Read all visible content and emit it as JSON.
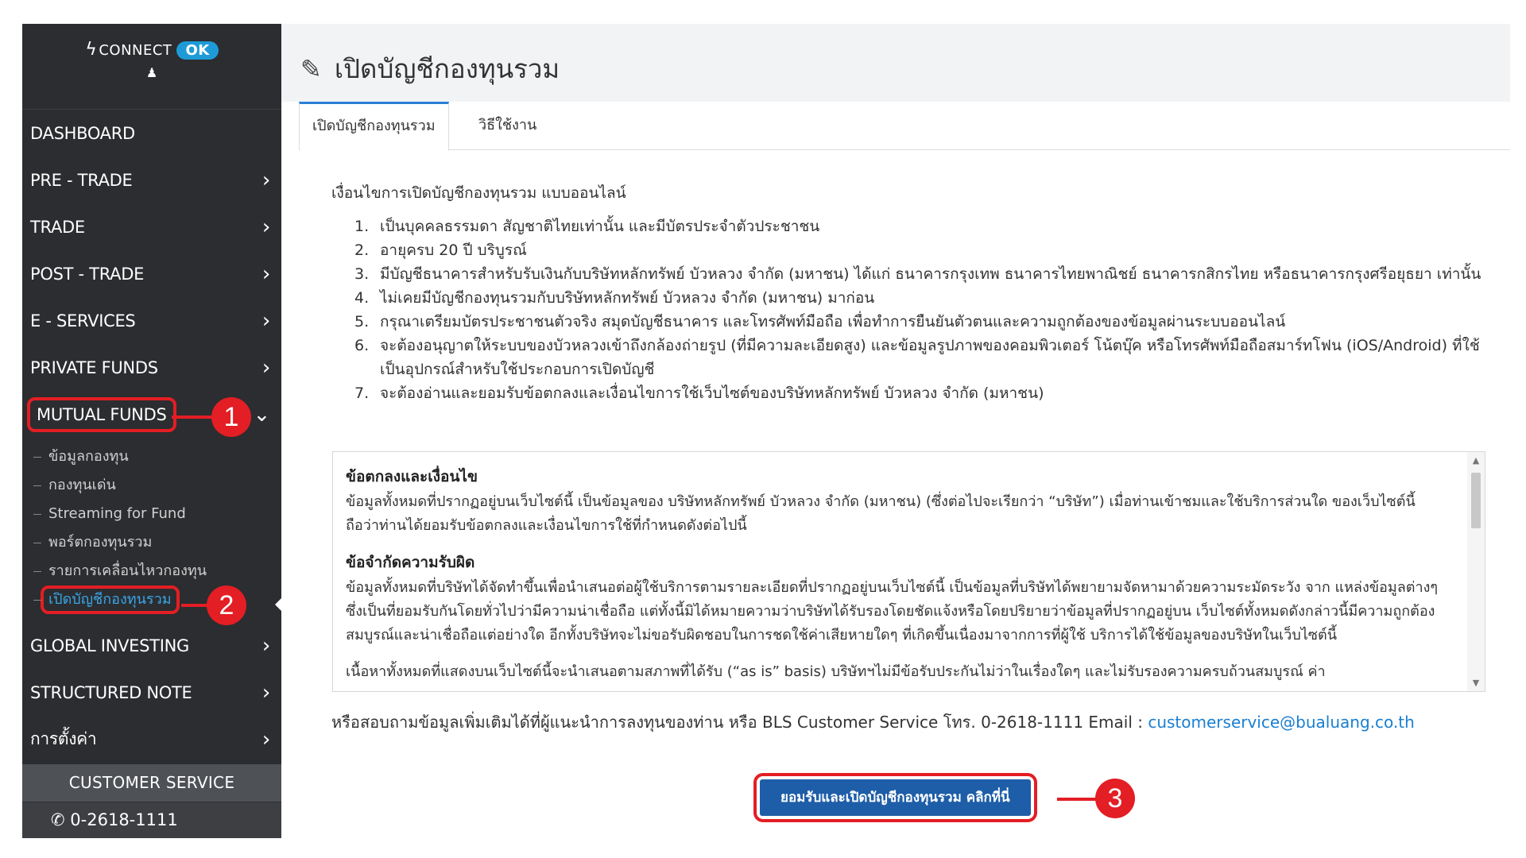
{
  "sidebar": {
    "connect_label": "CONNECT",
    "connect_status": "OK",
    "nav": [
      {
        "label": "DASHBOARD",
        "chevron": ""
      },
      {
        "label": "PRE - TRADE",
        "chevron": "›"
      },
      {
        "label": "TRADE",
        "chevron": "›"
      },
      {
        "label": "POST - TRADE",
        "chevron": "›"
      },
      {
        "label": "E - SERVICES",
        "chevron": "›"
      },
      {
        "label": "PRIVATE FUNDS",
        "chevron": "›"
      },
      {
        "label": "MUTUAL FUNDS",
        "chevron": "⌄"
      }
    ],
    "submenu": [
      "ข้อมูลกองทุน",
      "กองทุนเด่น",
      "Streaming for Fund",
      "พอร์ตกองทุนรวม",
      "รายการเคลื่อนไหวกองทุน",
      "เปิดบัญชีกองทุนรวม"
    ],
    "nav_bottom": [
      {
        "label": "GLOBAL INVESTING",
        "chevron": "›"
      },
      {
        "label": "STRUCTURED NOTE",
        "chevron": "›"
      },
      {
        "label": "การตั้งค่า",
        "chevron": "›"
      }
    ],
    "customer_service": "CUSTOMER SERVICE",
    "phone": "0-2618-1111"
  },
  "markers": [
    "1",
    "2",
    "3"
  ],
  "page": {
    "title": "เปิดบัญชีกองทุนรวม",
    "tabs": [
      "เปิดบัญชีกองทุนรวม",
      "วิธีใช้งาน"
    ],
    "intro": "เงื่อนไขการเปิดบัญชีกองทุนรวม แบบออนไลน์",
    "conditions": [
      {
        "num": "1.",
        "text": "เป็นบุคคลธรรมดา สัญชาติไทยเท่านั้น และมีบัตรประจำตัวประชาชน"
      },
      {
        "num": "2.",
        "text": "อายุครบ 20 ปี บริบูรณ์"
      },
      {
        "num": "3.",
        "text": "มีบัญชีธนาคารสำหรับรับเงินกับบริษัทหลักทรัพย์ บัวหลวง จำกัด (มหาชน) ได้แก่ ธนาคารกรุงเทพ ธนาคารไทยพาณิชย์ ธนาคารกสิกรไทย หรือธนาคารกรุงศรีอยุธยา เท่านั้น"
      },
      {
        "num": "4.",
        "text": "ไม่เคยมีบัญชีกองทุนรวมกับบริษัทหลักทรัพย์ บัวหลวง จำกัด (มหาชน) มาก่อน"
      },
      {
        "num": "5.",
        "text": "กรุณาเตรียมบัตรประชาชนตัวจริง สมุดบัญชีธนาคาร และโทรศัพท์มือถือ เพื่อทำการยืนยันตัวตนและความถูกต้องของข้อมูลผ่านระบบออนไลน์"
      },
      {
        "num": "6.",
        "text": "จะต้องอนุญาตให้ระบบของบัวหลวงเข้าถึงกล้องถ่ายรูป (ที่มีความละเอียดสูง) และข้อมูลรูปภาพของคอมพิวเตอร์ โน้ตบุ๊ค หรือโทรศัพท์มือถือสมาร์ทโฟน (iOS/Android) ที่ใช้เป็นอุปกรณ์สำหรับใช้ประกอบการเปิดบัญชี"
      },
      {
        "num": "7.",
        "text": "จะต้องอ่านและยอมรับข้อตกลงและเงื่อนไขการใช้เว็บไซต์ของบริษัทหลักทรัพย์ บัวหลวง จำกัด (มหาชน)"
      }
    ],
    "terms": {
      "h1": "ข้อตกลงและเงื่อนไข",
      "p1": "ข้อมูลทั้งหมดที่ปรากฏอยู่บนเว็บไซต์นี้ เป็นข้อมูลของ บริษัทหลักทรัพย์ บัวหลวง จำกัด (มหาชน) (ซึ่งต่อไปจะเรียกว่า “บริษัท”) เมื่อท่านเข้าชมและใช้บริการส่วนใด ของเว็บไซต์นี้ ถือว่าท่านได้ยอมรับข้อตกลงและเงื่อนไขการใช้ที่กำหนดดังต่อไปนี้",
      "h2": "ข้อจำกัดความรับผิด",
      "p2": "ข้อมูลทั้งหมดที่บริษัทได้จัดทำขึ้นเพื่อนำเสนอต่อผู้ใช้บริการตามรายละเอียดที่ปรากฏอยู่บนเว็บไซต์นี้ เป็นข้อมูลที่บริษัทได้พยายามจัดหามาด้วยความระมัดระวัง จาก แหล่งข้อมูลต่างๆ ซึ่งเป็นที่ยอมรับกันโดยทั่วไปว่ามีความน่าเชื่อถือ แต่ทั้งนี้มิได้หมายความว่าบริษัทได้รับรองโดยชัดแจ้งหรือโดยปริยายว่าข้อมูลที่ปรากฏอยู่บน เว็บไซต์ทั้งหมดดังกล่าวนี้มีความถูกต้องสมบูรณ์และน่าเชื่อถือแต่อย่างใด อีกทั้งบริษัทจะไม่ขอรับผิดชอบในการชดใช้ค่าเสียหายใดๆ ที่เกิดขึ้นเนื่องมาจากการที่ผู้ใช้ บริการได้ใช้ข้อมูลของบริษัทในเว็บไซต์นี้",
      "p3": "เนื้อหาทั้งหมดที่แสดงบนเว็บไซต์นี้จะนำเสนอตามสภาพที่ได้รับ (“as is” basis) บริษัทฯไม่มีข้อรับประกันไม่ว่าในเรื่องใดๆ และไม่รับรองความครบถ้วนสมบูรณ์ ค่า"
    },
    "contact_prefix": "หรือสอบถามข้อมูลเพิ่มเติมได้ที่ผู้แนะนำการลงทุนของท่าน หรือ BLS Customer Service โทร. 0-2618-1111 Email : ",
    "contact_email": "customerservice@bualuang.co.th",
    "accept_button": "ยอมรับและเปิดบัญชีกองทุนรวม คลิกที่นี่"
  }
}
